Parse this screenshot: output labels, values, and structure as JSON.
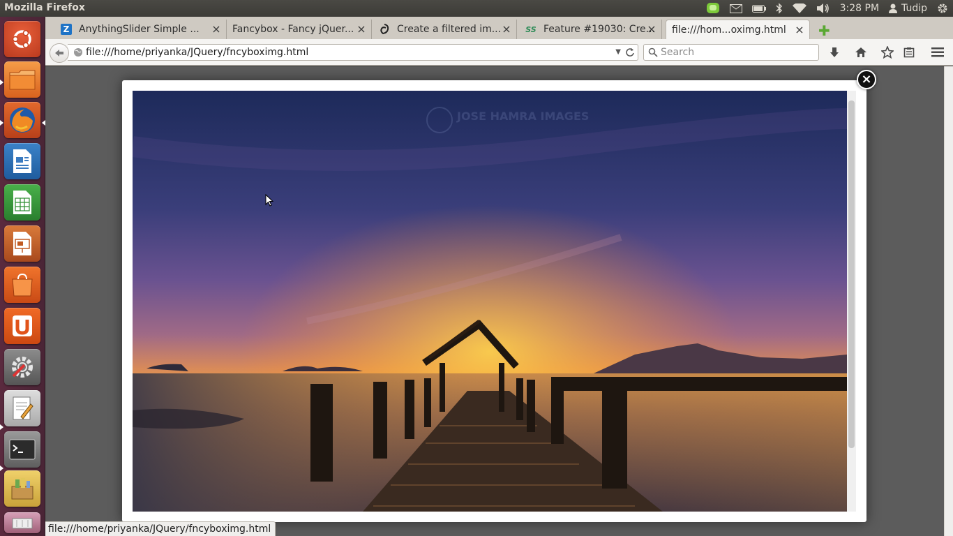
{
  "top_panel": {
    "window_title": "Mozilla Firefox",
    "clock": "3:28 PM",
    "user": "Tudip"
  },
  "browser": {
    "tabs": [
      {
        "title": "AnythingSlider Simple ...",
        "favicon": "zotero-z-icon",
        "active": false
      },
      {
        "title": "Fancybox - Fancy jQuer...",
        "favicon": "blank-page-icon",
        "active": false
      },
      {
        "title": "Create a filtered im...",
        "favicon": "swirl-logo-icon",
        "active": false
      },
      {
        "title": "Feature #19030: Cre...",
        "favicon": "ss-logo-icon",
        "active": false
      },
      {
        "title": "file:///hom...oximg.html",
        "favicon": "none",
        "active": true
      }
    ],
    "url": "file:///home/priyanka/JQuery/fncyboximg.html",
    "search_placeholder": "Search",
    "status_url": "file:///home/priyanka/JQuery/fncyboximg.html"
  },
  "lightbox": {
    "watermark": "JOSE HAMRA IMAGES",
    "close_label": "×"
  },
  "colors": {
    "launcher_bg": "#4f2739",
    "panel_bg": "#3c3b37",
    "page_overlay": "#5c5c5c"
  }
}
